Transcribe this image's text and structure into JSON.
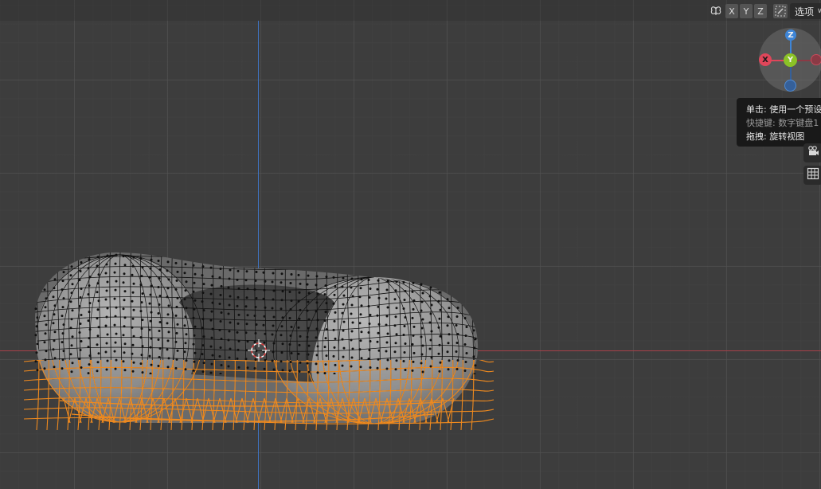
{
  "header": {
    "axis_labels": [
      "X",
      "Y",
      "Z"
    ],
    "options_label": "选项",
    "mirror_icon": "mirror-butterfly-icon",
    "snap_icon": "snap-icon"
  },
  "gizmo": {
    "x_label": "X",
    "y_label": "Y",
    "z_label": "Z",
    "colors": {
      "x": "#e0465a",
      "y": "#8bc126",
      "z": "#3e85d7"
    }
  },
  "tooltip": {
    "line1": "单击: 使用一个预设",
    "line2": "快捷键: 数字键盘1",
    "line3": "拖拽: 旋转视图"
  },
  "nav_icons": [
    "camera-icon",
    "grid-icon"
  ],
  "colors": {
    "background": "#3d3d3d",
    "wire_black": "#111111",
    "wire_orange": "#f08a1e",
    "x_axis": "#a64048",
    "z_axis": "#3f73bf"
  }
}
